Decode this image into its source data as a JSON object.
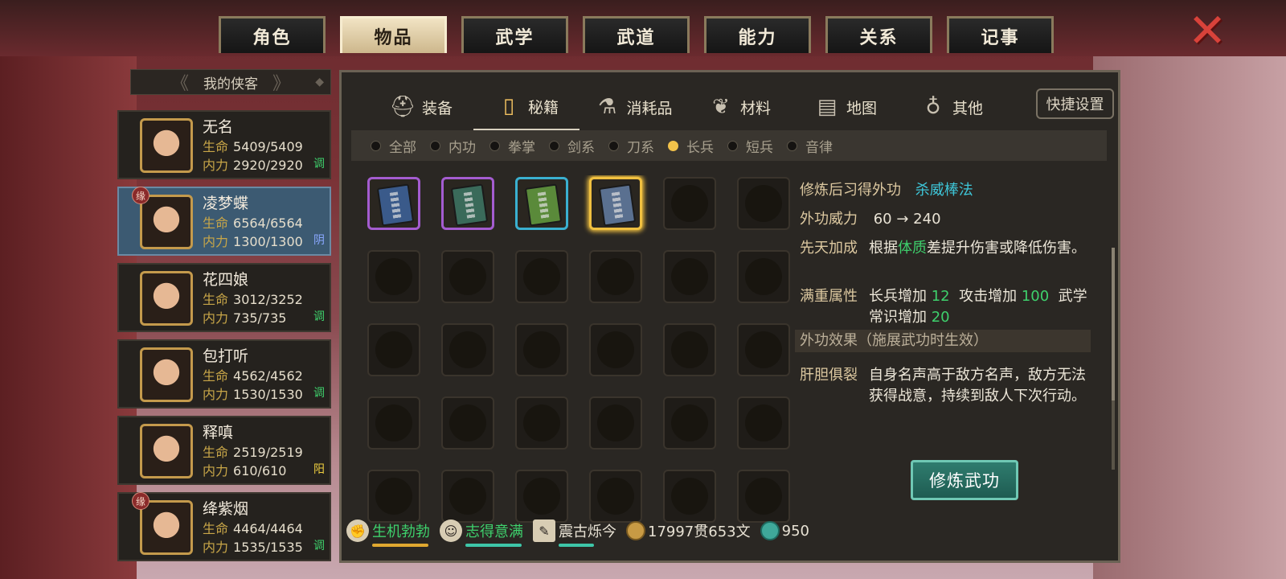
{
  "top_tabs": [
    {
      "label": "角色",
      "active": false
    },
    {
      "label": "物品",
      "active": true
    },
    {
      "label": "武学",
      "active": false
    },
    {
      "label": "武道",
      "active": false
    },
    {
      "label": "能力",
      "active": false
    },
    {
      "label": "关系",
      "active": false
    },
    {
      "label": "记事",
      "active": false
    }
  ],
  "close_icon": "close-x-icon",
  "roster": {
    "title": "我的侠客",
    "characters": [
      {
        "name": "无名",
        "hp_label": "生命",
        "hp": "5409/5409",
        "mp_label": "内力",
        "mp": "2920/2920",
        "tag": "调",
        "tag_color": "#3ed06c",
        "selected": false,
        "mark": ""
      },
      {
        "name": "凌梦蝶",
        "hp_label": "生命",
        "hp": "6564/6564",
        "mp_label": "内力",
        "mp": "1300/1300",
        "tag": "阴",
        "tag_color": "#8aa8ff",
        "selected": true,
        "mark": "缘"
      },
      {
        "name": "花四娘",
        "hp_label": "生命",
        "hp": "3012/3252",
        "mp_label": "内力",
        "mp": "735/735",
        "tag": "调",
        "tag_color": "#3ed06c",
        "selected": false,
        "mark": ""
      },
      {
        "name": "包打听",
        "hp_label": "生命",
        "hp": "4562/4562",
        "mp_label": "内力",
        "mp": "1530/1530",
        "tag": "调",
        "tag_color": "#3ed06c",
        "selected": false,
        "mark": ""
      },
      {
        "name": "释嗔",
        "hp_label": "生命",
        "hp": "2519/2519",
        "mp_label": "内力",
        "mp": "610/610",
        "tag": "阳",
        "tag_color": "#f0d040",
        "selected": false,
        "mark": ""
      },
      {
        "name": "绛紫烟",
        "hp_label": "生命",
        "hp": "4464/4464",
        "mp_label": "内力",
        "mp": "1535/1535",
        "tag": "调",
        "tag_color": "#3ed06c",
        "selected": false,
        "mark": "缘"
      }
    ]
  },
  "categories": [
    {
      "label": "装备",
      "icon": "helmet-icon",
      "active": false
    },
    {
      "label": "秘籍",
      "icon": "book-icon",
      "active": true
    },
    {
      "label": "消耗品",
      "icon": "potion-icon",
      "active": false
    },
    {
      "label": "材料",
      "icon": "herb-icon",
      "active": false
    },
    {
      "label": "地图",
      "icon": "map-icon",
      "active": false
    },
    {
      "label": "其他",
      "icon": "misc-icon",
      "active": false
    }
  ],
  "quick_settings": "快捷设置",
  "filters": [
    {
      "label": "全部",
      "on": false
    },
    {
      "label": "内功",
      "on": false
    },
    {
      "label": "拳掌",
      "on": false
    },
    {
      "label": "剑系",
      "on": false
    },
    {
      "label": "刀系",
      "on": false
    },
    {
      "label": "长兵",
      "on": true
    },
    {
      "label": "短兵",
      "on": false
    },
    {
      "label": "音律",
      "on": false
    }
  ],
  "items": [
    {
      "name": "manual-book-1",
      "frame": "#a45cd0",
      "cover": "#3a5a8a"
    },
    {
      "name": "manual-book-2",
      "frame": "#a45cd0",
      "cover": "#3a6a5a"
    },
    {
      "name": "manual-book-3",
      "frame": "#3ab0d0",
      "cover": "#5a8a3a"
    },
    {
      "name": "manual-book-4",
      "frame": "#f0c040",
      "cover": "#5a7090",
      "selected": true
    }
  ],
  "detail": {
    "learn_label": "修炼后习得外功",
    "learn_value": "杀威棒法",
    "power_label": "外功威力",
    "power_value": "60 → 240",
    "innate_label": "先天加成",
    "innate_pre": "根据",
    "innate_hl": "体质",
    "innate_post": "差提升伤害或降低伤害。",
    "full_label": "满重属性",
    "full_a": "长兵增加",
    "full_a_val": "12",
    "full_b": "攻击增加",
    "full_b_val": "100",
    "full_c": "武学常识增加",
    "full_c_val": "20",
    "effect_header": "外功效果（施展武功时生效）",
    "effect_label": "肝胆俱裂",
    "effect_text": "自身名声高于敌方名声，敌方无法获得战意，持续到敌人下次行动。"
  },
  "train_button": "修炼武功",
  "status": {
    "s1": {
      "label": "生机勃勃",
      "icon": "muscle-icon",
      "color": "#3ed06c",
      "bar_color": "#e0a830",
      "level": 0.95
    },
    "s2": {
      "label": "志得意满",
      "icon": "face-icon",
      "color": "#3ed06c",
      "bar_color": "#3ec6a8",
      "level": 0.95
    },
    "s3": {
      "label": "震古烁今",
      "icon": "scroll-icon",
      "color": "#ece6d8",
      "bar_color": "#3ec6a8",
      "level": 0.6
    },
    "money": "17997贯653文",
    "money_icon": "coin-icon",
    "jade": "950",
    "jade_icon": "jade-icon"
  }
}
